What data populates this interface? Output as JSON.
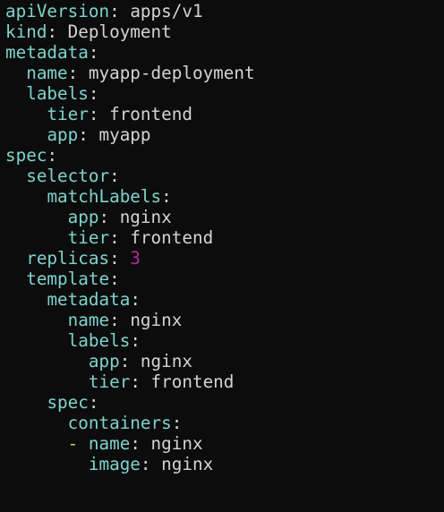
{
  "colors": {
    "background": "#0c0c0c",
    "key": "#7fd3ce",
    "text": "#d4d4d4",
    "number": "#b02ba4",
    "list_dash": "#e5c07b"
  },
  "lines": [
    {
      "indent": "",
      "dash": "",
      "key": "apiVersion",
      "value": "apps/v1",
      "number": ""
    },
    {
      "indent": "",
      "dash": "",
      "key": "kind",
      "value": "Deployment",
      "number": ""
    },
    {
      "indent": "",
      "dash": "",
      "key": "metadata",
      "value": "",
      "number": ""
    },
    {
      "indent": "  ",
      "dash": "",
      "key": "name",
      "value": "myapp-deployment",
      "number": ""
    },
    {
      "indent": "  ",
      "dash": "",
      "key": "labels",
      "value": "",
      "number": ""
    },
    {
      "indent": "    ",
      "dash": "",
      "key": "tier",
      "value": "frontend",
      "number": ""
    },
    {
      "indent": "    ",
      "dash": "",
      "key": "app",
      "value": "myapp",
      "number": ""
    },
    {
      "indent": "",
      "dash": "",
      "key": "spec",
      "value": "",
      "number": ""
    },
    {
      "indent": "  ",
      "dash": "",
      "key": "selector",
      "value": "",
      "number": ""
    },
    {
      "indent": "    ",
      "dash": "",
      "key": "matchLabels",
      "value": "",
      "number": ""
    },
    {
      "indent": "      ",
      "dash": "",
      "key": "app",
      "value": "nginx",
      "number": ""
    },
    {
      "indent": "      ",
      "dash": "",
      "key": "tier",
      "value": "frontend",
      "number": ""
    },
    {
      "indent": "  ",
      "dash": "",
      "key": "replicas",
      "value": "",
      "number": "3"
    },
    {
      "indent": "  ",
      "dash": "",
      "key": "template",
      "value": "",
      "number": ""
    },
    {
      "indent": "    ",
      "dash": "",
      "key": "metadata",
      "value": "",
      "number": ""
    },
    {
      "indent": "      ",
      "dash": "",
      "key": "name",
      "value": "nginx",
      "number": ""
    },
    {
      "indent": "      ",
      "dash": "",
      "key": "labels",
      "value": "",
      "number": ""
    },
    {
      "indent": "        ",
      "dash": "",
      "key": "app",
      "value": "nginx",
      "number": ""
    },
    {
      "indent": "        ",
      "dash": "",
      "key": "tier",
      "value": "frontend",
      "number": ""
    },
    {
      "indent": "    ",
      "dash": "",
      "key": "spec",
      "value": "",
      "number": ""
    },
    {
      "indent": "      ",
      "dash": "",
      "key": "containers",
      "value": "",
      "number": ""
    },
    {
      "indent": "      ",
      "dash": "- ",
      "key": "name",
      "value": "nginx",
      "number": ""
    },
    {
      "indent": "        ",
      "dash": "",
      "key": "image",
      "value": "nginx",
      "number": ""
    }
  ]
}
